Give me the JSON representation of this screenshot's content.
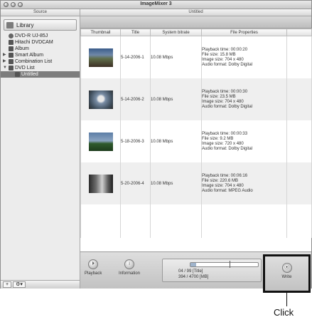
{
  "window": {
    "title": "ImageMixer 3"
  },
  "sidebar": {
    "header": "Source",
    "library_label": "Library",
    "items": [
      {
        "label": "DVD-R  UJ-85J",
        "icon": "disc-icon",
        "indent": 0,
        "selected": false,
        "triangle": ""
      },
      {
        "label": "Hitachi DVDCAM",
        "icon": "camera-icon",
        "indent": 0,
        "selected": false,
        "triangle": ""
      },
      {
        "label": "Album",
        "icon": "album-icon",
        "indent": 0,
        "selected": false,
        "triangle": ""
      },
      {
        "label": "Smart Album",
        "icon": "smart-album-icon",
        "indent": 0,
        "selected": false,
        "triangle": "▶"
      },
      {
        "label": "Combination List",
        "icon": "list-icon",
        "indent": 0,
        "selected": false,
        "triangle": "▶"
      },
      {
        "label": "DVD List",
        "icon": "list-icon",
        "indent": 0,
        "selected": false,
        "triangle": "▼"
      },
      {
        "label": "Untitled",
        "icon": "dvd-item-icon",
        "indent": 1,
        "selected": true,
        "triangle": ""
      }
    ],
    "footer": {
      "add": "+",
      "action": "⚙▾"
    }
  },
  "main": {
    "header": "Untitled",
    "columns": [
      "Thumbnail",
      "Title",
      "System bitrate",
      "File Properties"
    ],
    "rows": [
      {
        "title": "5-14-2006-1",
        "bitrate": "10.08 Mbps",
        "playback": "Playback time: 00:00:20",
        "filesize": "File size: 15.8 MB",
        "imagesize": "Image size: 704 x 480",
        "audio": "Audio format: Dolby Digital"
      },
      {
        "title": "5-14-2006-2",
        "bitrate": "10.08 Mbps",
        "playback": "Playback time: 00:00:30",
        "filesize": "File size: 23.5 MB",
        "imagesize": "Image size: 704 x 480",
        "audio": "Audio format: Dolby Digital"
      },
      {
        "title": "5-18-2006-3",
        "bitrate": "10.08 Mbps",
        "playback": "Playback time: 00:00:33",
        "filesize": "File size: 9.2 MB",
        "imagesize": "Image size: 720 x 480",
        "audio": "Audio format: Dolby Digital"
      },
      {
        "title": "5-20-2006-4",
        "bitrate": "10.08 Mbps",
        "playback": "Playback time: 00:06:16",
        "filesize": "File size: 220.6 MB",
        "imagesize": "Image size: 704 x 480",
        "audio": "Audio format: MPEG Audio"
      }
    ]
  },
  "bottom": {
    "playback_label": "Playback",
    "information_label": "Information",
    "capacity": {
      "titles": "04 / 99 [Title]",
      "mb": "394 / 4700 [MB]",
      "used_fraction": 0.08
    },
    "write_label": "Write"
  },
  "annotation": {
    "click_label": "Click"
  }
}
